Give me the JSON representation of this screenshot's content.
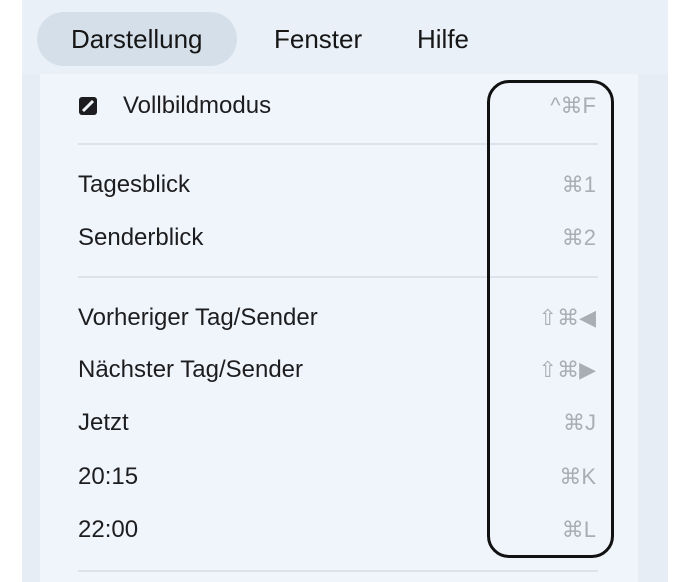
{
  "menubar": {
    "items": [
      {
        "label": "Darstellung"
      },
      {
        "label": "Fenster"
      },
      {
        "label": "Hilfe"
      }
    ]
  },
  "menu": {
    "items": [
      {
        "label": "Vollbildmodus",
        "shortcut": "^⌘F",
        "icon": "fullscreen-icon"
      },
      {
        "label": "Tagesblick",
        "shortcut": "⌘1"
      },
      {
        "label": "Senderblick",
        "shortcut": "⌘2"
      },
      {
        "label": "Vorheriger Tag/Sender",
        "shortcut": "⇧⌘◀"
      },
      {
        "label": "Nächster Tag/Sender",
        "shortcut": "⇧⌘▶"
      },
      {
        "label": "Jetzt",
        "shortcut": "⌘J"
      },
      {
        "label": "20:15",
        "shortcut": "⌘K"
      },
      {
        "label": "22:00",
        "shortcut": "⌘L"
      }
    ]
  },
  "colors": {
    "menubar_bg": "#e9f0f7",
    "active_pill": "#d4dfe9",
    "menu_bg": "#f0f5fb",
    "shortcut_text": "#a9aeb4",
    "highlight_border": "#111111"
  }
}
